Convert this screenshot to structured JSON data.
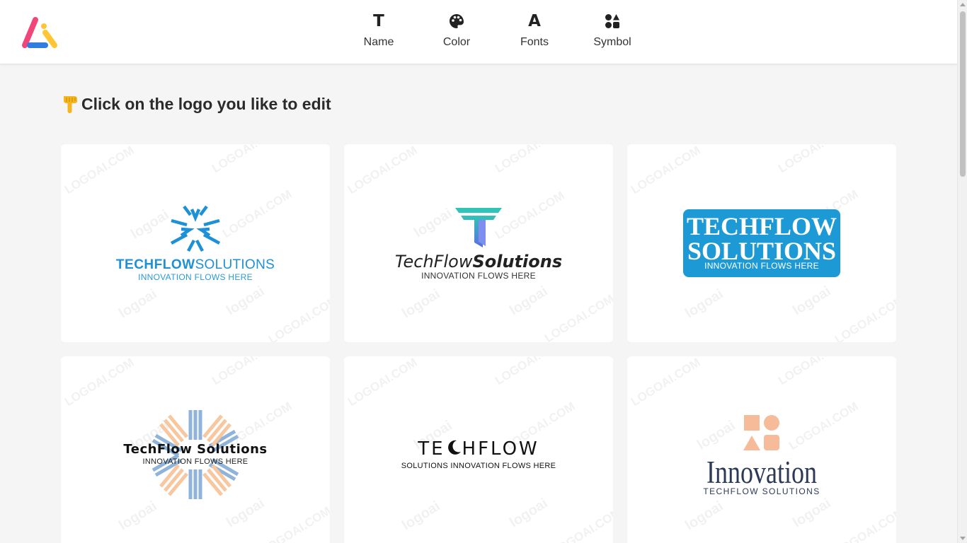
{
  "app": {
    "brand": "logoai"
  },
  "nav": {
    "items": [
      {
        "label": "Name",
        "icon": "text-t-icon",
        "glyph": "T"
      },
      {
        "label": "Color",
        "icon": "palette-icon"
      },
      {
        "label": "Fonts",
        "icon": "font-a-icon",
        "glyph": "A"
      },
      {
        "label": "Symbol",
        "icon": "shapes-icon"
      }
    ]
  },
  "main": {
    "heading": "Click on the logo you like to edit",
    "heading_icon": "pointing-down-hand-icon"
  },
  "watermark": {
    "text": "LOGOAI.COM",
    "brand": "logoai"
  },
  "logos": [
    {
      "name_bold": "TECHFLOW",
      "name_light": "SOLUTIONS",
      "tagline": "INNOVATION FLOWS HERE",
      "symbol": "snowflake-arrows-icon",
      "colors": {
        "primary": "#1e90d6"
      }
    },
    {
      "name_light": "TechFlow",
      "name_bold": "Solutions",
      "tagline": "INNOVATION FLOWS HERE",
      "symbol": "letter-t-gradient-icon",
      "colors": {
        "top": "#2ec4b6",
        "bottom": "#5b6ee1"
      }
    },
    {
      "name_line1": "TECHFLOW",
      "name_line2": "SOLUTIONS",
      "tagline": "INNOVATION FLOWS HERE",
      "symbol": "none",
      "colors": {
        "badge": "#1d9ad6",
        "text": "#ffffff"
      }
    },
    {
      "name": "TechFlow Solutions",
      "tagline": "INNOVATION FLOWS HERE",
      "symbol": "striped-sunburst-icon",
      "colors": {
        "blue": "#8fb3d9",
        "peach": "#f7c8a0"
      }
    },
    {
      "name_before": "TE",
      "name_after": "HFLOW",
      "tagline": "SOLUTIONS INNOVATION FLOWS HERE",
      "symbol": "crescent-moon-c-icon",
      "colors": {
        "text": "#111111"
      }
    },
    {
      "name": "Innovation",
      "tagline": "TECHFLOW SOLUTIONS",
      "symbol": "four-shapes-icon",
      "colors": {
        "shapes": "#f6bb98",
        "text": "#2d3a57"
      }
    }
  ]
}
